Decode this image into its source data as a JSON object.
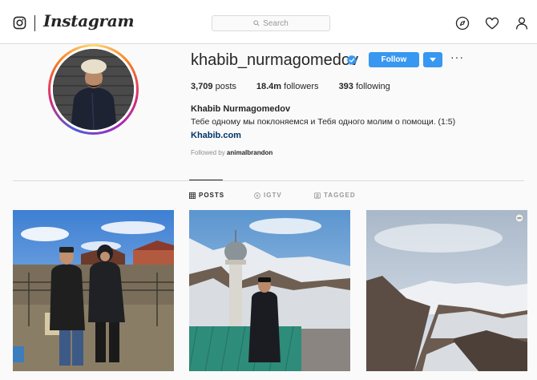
{
  "nav": {
    "wordmark": "Instagram",
    "search_placeholder": "Search",
    "icons": [
      "instagram-glyph-icon",
      "search-icon",
      "compass-icon",
      "heart-icon",
      "user-icon"
    ]
  },
  "profile": {
    "username": "khabib_nurmagomedov",
    "verified": true,
    "follow_label": "Follow",
    "stats": {
      "posts": "3,709",
      "posts_label": "posts",
      "followers": "18.4m",
      "followers_label": "followers",
      "following": "393",
      "following_label": "following"
    },
    "full_name": "Khabib Nurmagomedov",
    "bio": "Тебе одному мы поклоняемся и Тебя одного молим о помощи. (1:5)",
    "link": "Khabib.com",
    "followed_by_prefix": "Followed by",
    "followed_by_user": "animalbrandon"
  },
  "tabs": [
    {
      "label": "POSTS",
      "active": true
    },
    {
      "label": "IGTV",
      "active": false
    },
    {
      "label": "TAGGED",
      "active": false
    }
  ],
  "colors": {
    "accent": "#3897f0",
    "link": "#003569",
    "border": "#dbdbdb",
    "background": "#fafafa"
  }
}
